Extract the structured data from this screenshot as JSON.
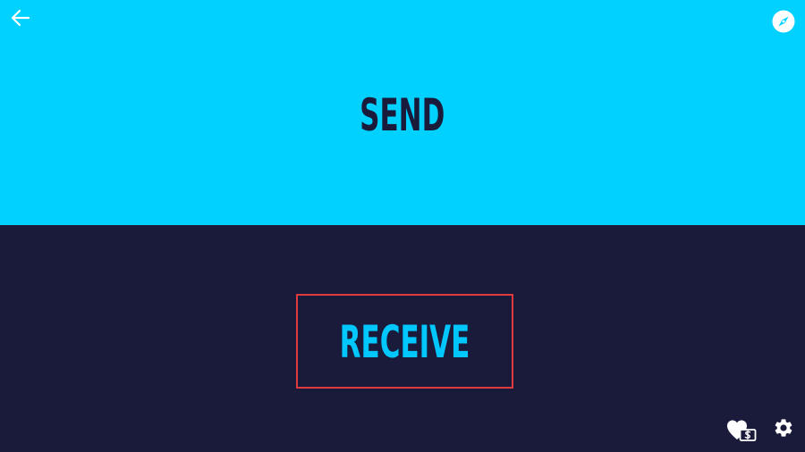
{
  "send": {
    "label": "SEND"
  },
  "receive": {
    "label": "RECEIVE"
  },
  "icons": {
    "back": "arrow-left-icon",
    "compass": "compass-icon",
    "donate": "heart-dollar-icon",
    "settings": "gear-icon"
  },
  "colors": {
    "send_bg": "#00d1ff",
    "send_text": "#1a1b3b",
    "receive_bg": "#1a1b3b",
    "receive_text": "#00c8ff",
    "highlight_border": "#e03a3e",
    "icon": "#ffffff"
  }
}
